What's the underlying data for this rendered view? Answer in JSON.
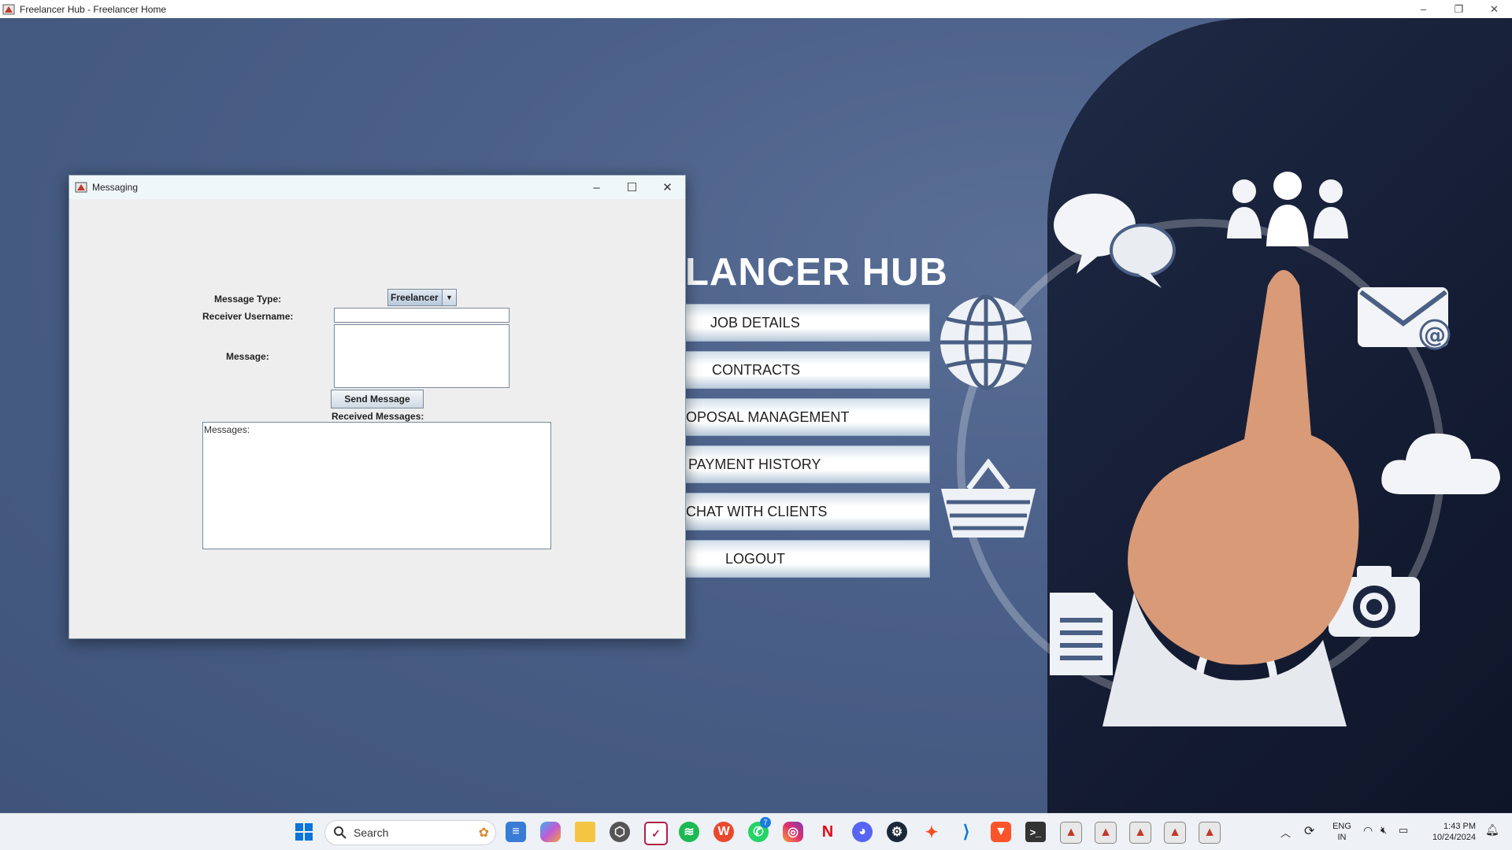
{
  "main_window": {
    "title": "Freelancer Hub - Freelancer Home",
    "controls": {
      "minimize": "–",
      "restore": "❐",
      "close": "✕"
    }
  },
  "hub": {
    "title_visible": "LANCER HUB",
    "menu": [
      {
        "label": "JOB DETAILS"
      },
      {
        "label": "CONTRACTS"
      },
      {
        "label": "OPOSAL MANAGEMENT"
      },
      {
        "label": "PAYMENT HISTORY"
      },
      {
        "label": "CHAT WITH CLIENTS"
      },
      {
        "label": "LOGOUT"
      }
    ]
  },
  "dialog": {
    "title": "Messaging",
    "controls": {
      "minimize": "–",
      "maximize": "☐",
      "close": "✕"
    },
    "message_type_label": "Message Type:",
    "message_type_value": "Freelancer",
    "receiver_label": "Receiver Username:",
    "receiver_value": "",
    "message_label": "Message:",
    "message_value": "",
    "send_button": "Send Message",
    "received_label": "Received Messages:",
    "messages_text": "Messages:"
  },
  "taskbar": {
    "search_placeholder": "Search",
    "whatsapp_badge": "7",
    "language": "ENG",
    "region": "IN",
    "time": "1:43 PM",
    "date": "10/24/2024"
  },
  "colors": {
    "background": "#4a5f84",
    "menu_button": "#ffffff",
    "dialog_bg": "#eeeeee"
  }
}
